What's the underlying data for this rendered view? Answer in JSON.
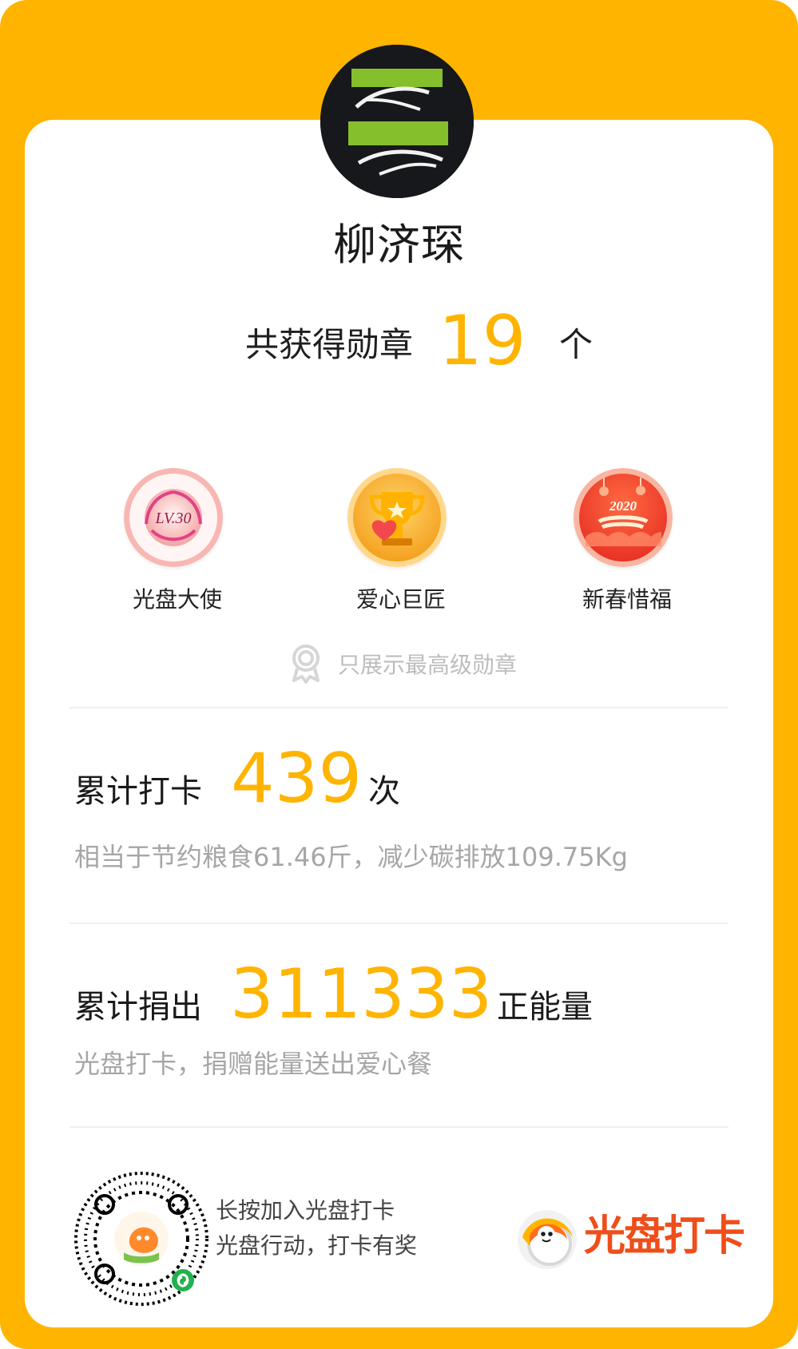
{
  "colors": {
    "frame": "#FFB400",
    "card": "#ffffff",
    "accent": "#FFB400",
    "text_primary": "#1a1a1a",
    "text_muted": "#a6a6a6",
    "brand_red": "#EF4D1A"
  },
  "profile": {
    "name": "柳济琛",
    "avatar_icon": "avatar-image"
  },
  "badges": {
    "summary_prefix": "共获得勋章",
    "count": "19",
    "summary_suffix": "个",
    "items": [
      {
        "label": "光盘大使",
        "badge_text": "LV.30",
        "icon": "level-badge-icon"
      },
      {
        "label": "爱心巨匠",
        "badge_text": "",
        "icon": "trophy-heart-badge-icon"
      },
      {
        "label": "新春惜福",
        "badge_text": "2020",
        "icon": "new-year-badge-icon"
      }
    ],
    "note": "只展示最高级勋章",
    "note_icon": "medal-icon"
  },
  "stats": {
    "checkin": {
      "title": "累计打卡",
      "value": "439",
      "unit": "次",
      "description": "相当于节约粮食61.46斤，减少碳排放109.75Kg"
    },
    "donation": {
      "title": "累计捐出",
      "value": "311333",
      "unit": "正能量",
      "description": "光盘打卡，捐赠能量送出爱心餐"
    }
  },
  "footer": {
    "line1": "长按加入光盘打卡",
    "line2": "光盘行动，打卡有奖",
    "logo_text": "光盘打卡",
    "qr_icon": "qr-code-icon",
    "logo_icon": "brand-logo-icon"
  }
}
